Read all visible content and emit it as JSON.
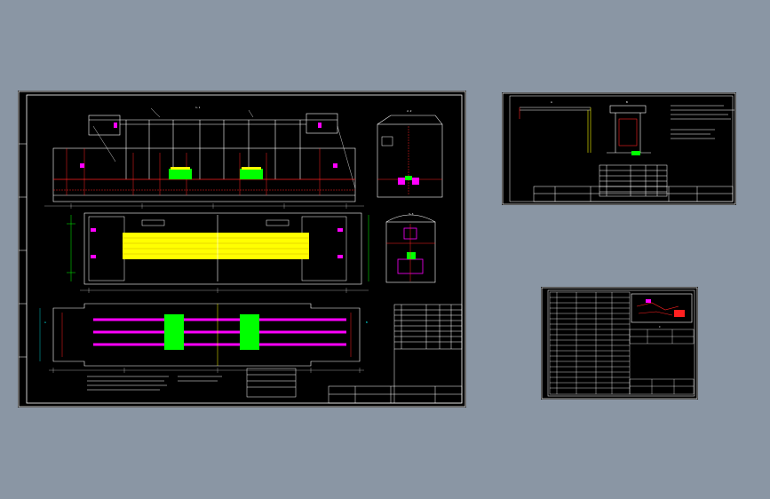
{
  "viewer": {
    "background": "#8a96a4",
    "canvas_color": "#000000",
    "line_colors": {
      "outline": "#ffffff",
      "cyan": "#00ffff",
      "red": "#ff2020",
      "yellow": "#ffff00",
      "magenta": "#ff00ff",
      "green": "#00ff00"
    }
  },
  "sheets": {
    "main": {
      "view_labels": [
        "1-1",
        "2-2",
        "3-3",
        "A",
        "B"
      ],
      "north_mark": "N"
    },
    "detail": {
      "view_labels": [
        "A",
        "B"
      ]
    },
    "schedule": {
      "view_labels": [
        "C"
      ]
    }
  }
}
